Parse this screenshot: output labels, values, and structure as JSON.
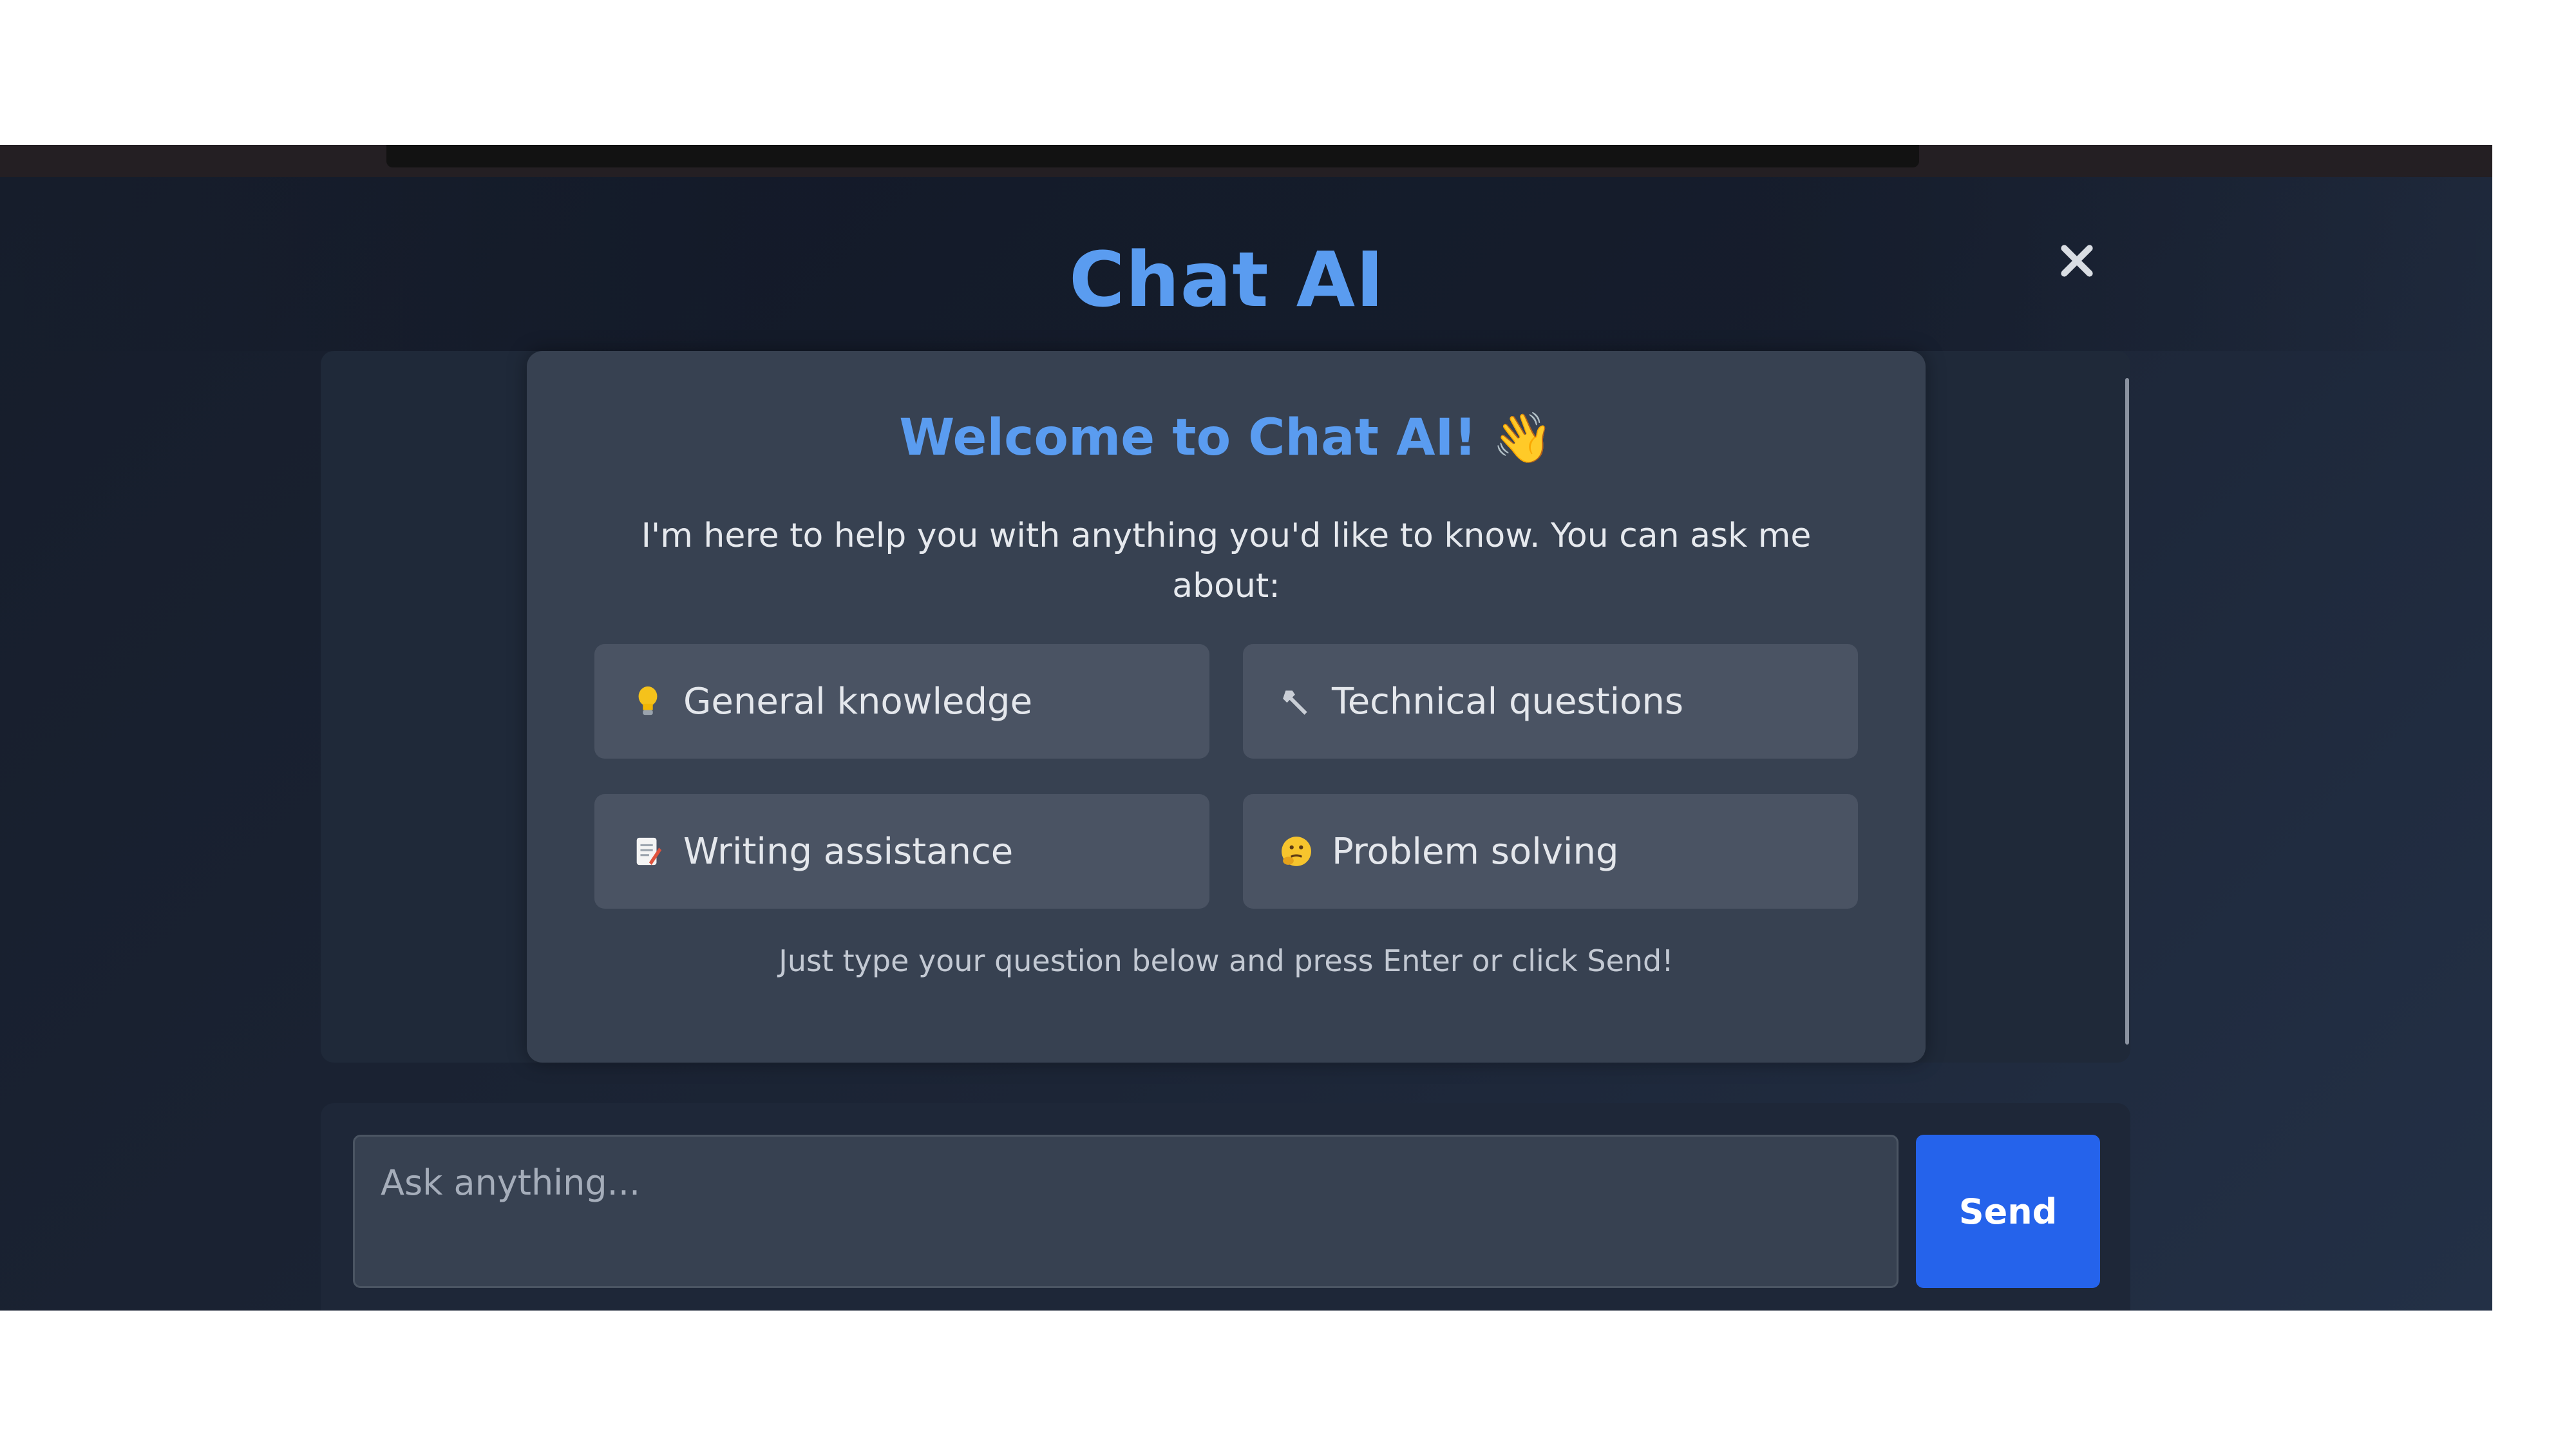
{
  "app": {
    "title": "Chat AI"
  },
  "welcome": {
    "title": "Welcome to Chat AI!",
    "wave_emoji": "👋",
    "intro": "I'm here to help you with anything you'd like to know. You can ask me about:",
    "hint": "Just type your question below and press Enter or click Send!"
  },
  "topics": [
    {
      "icon": "lightbulb-icon",
      "label": "General knowledge"
    },
    {
      "icon": "wrench-icon",
      "label": "Technical questions"
    },
    {
      "icon": "memo-icon",
      "label": "Writing assistance"
    },
    {
      "icon": "thinking-face-icon",
      "label": "Problem solving"
    }
  ],
  "input": {
    "placeholder": "Ask anything...",
    "value": ""
  },
  "send_button": {
    "label": "Send"
  },
  "colors": {
    "accent": "#5a9cf0",
    "send_button": "#2563eb",
    "card_bg": "#374151",
    "topic_bg": "#4a5363"
  }
}
